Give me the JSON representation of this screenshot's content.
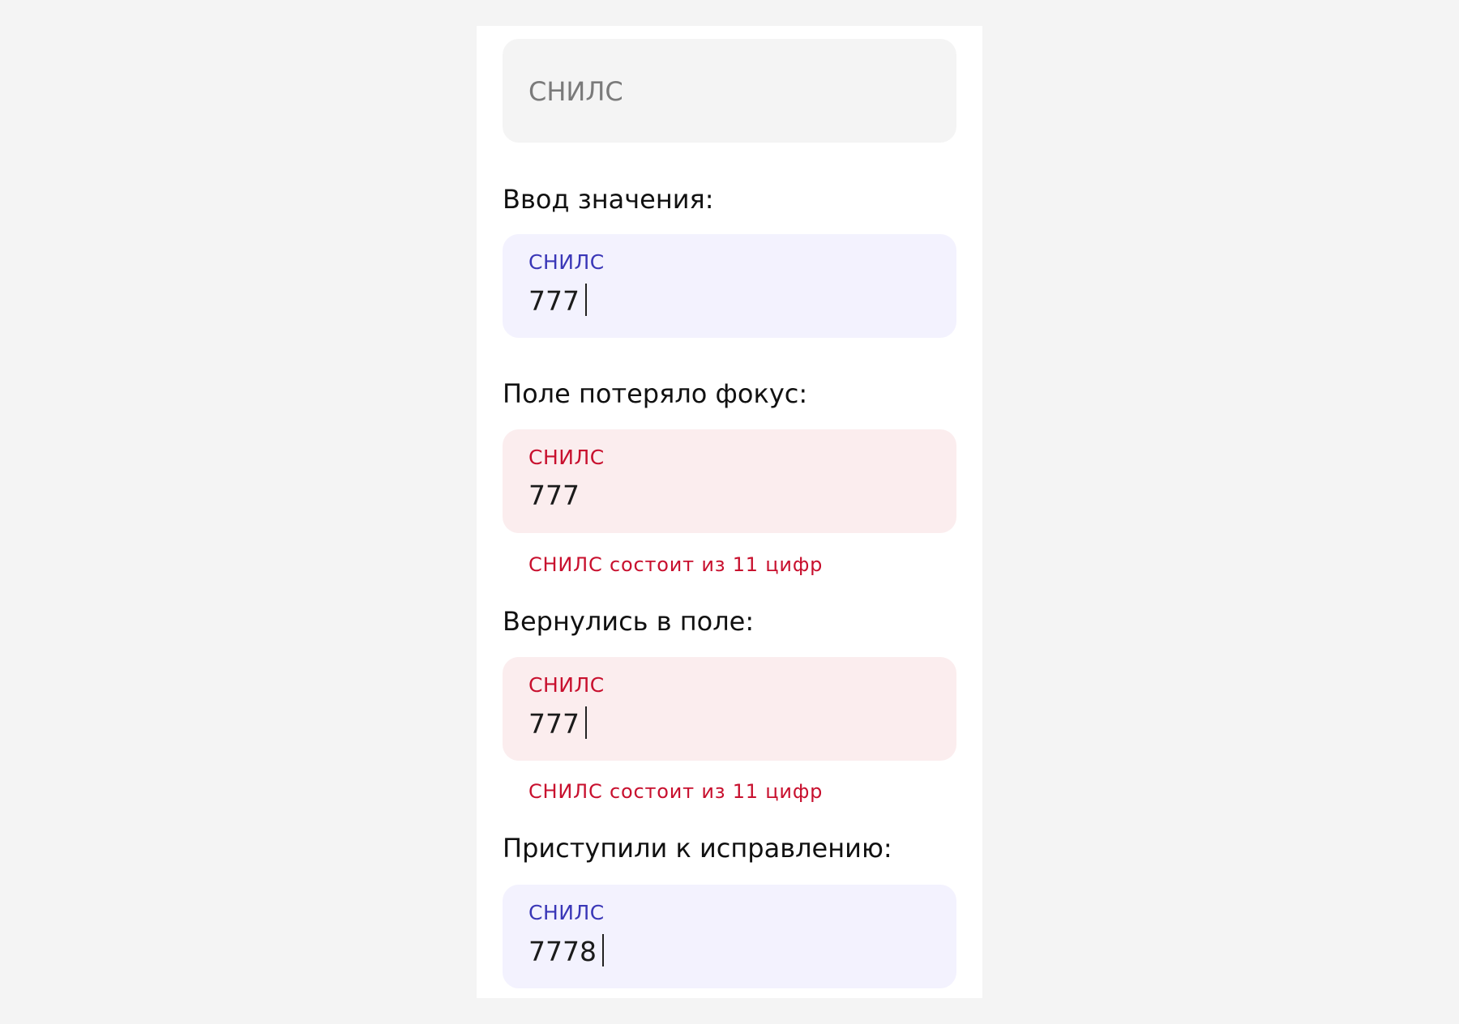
{
  "field_label": "СНИЛС",
  "default_state": {
    "placeholder": "СНИЛС"
  },
  "states": [
    {
      "title": "Ввод значения:",
      "label": "СНИЛС",
      "value": "777",
      "status": "focused",
      "caret": true
    },
    {
      "title": "Поле потеряло фокус:",
      "label": "СНИЛС",
      "value": "777",
      "status": "error",
      "caret": false,
      "error": "СНИЛС состоит из 11 цифр"
    },
    {
      "title": "Вернулись в поле:",
      "label": "СНИЛС",
      "value": "777",
      "status": "error",
      "caret": true,
      "error": "СНИЛС состоит из 11 цифр"
    },
    {
      "title": "Приступили к исправлению:",
      "label": "СНИЛС",
      "value": "7778",
      "status": "focused",
      "caret": true
    }
  ],
  "colors": {
    "page_background": "#f4f4f4",
    "panel_background": "#ffffff",
    "field_default": "#f4f4f4",
    "field_focused": "#f3f2fe",
    "field_error": "#fbedee",
    "label_focused": "#3a37b7",
    "label_error": "#c8102e",
    "error_text": "#c8102e"
  }
}
